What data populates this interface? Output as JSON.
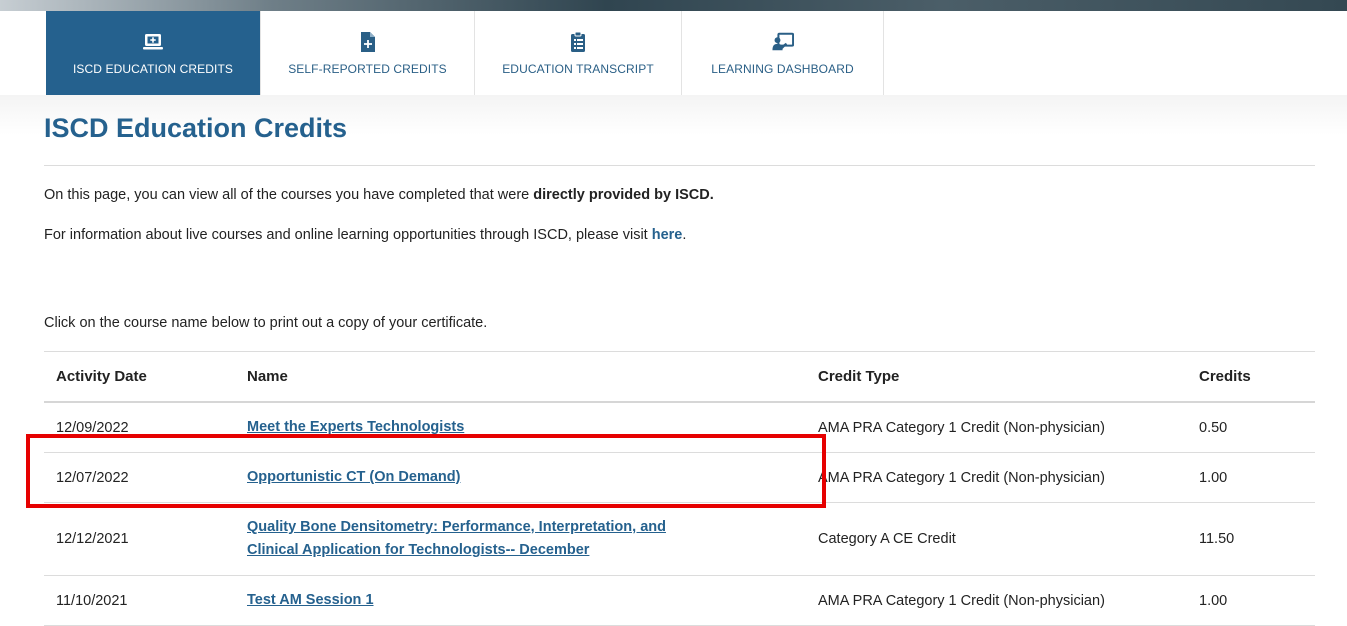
{
  "tabs": [
    {
      "label": "ISCD EDUCATION CREDITS",
      "icon": "laptop-plus-icon",
      "active": true
    },
    {
      "label": "SELF-REPORTED CREDITS",
      "icon": "file-plus-icon",
      "active": false
    },
    {
      "label": "EDUCATION TRANSCRIPT",
      "icon": "clipboard-list-icon",
      "active": false
    },
    {
      "label": "LEARNING DASHBOARD",
      "icon": "presenter-board-icon",
      "active": false
    }
  ],
  "page": {
    "title": "ISCD Education Credits",
    "intro_prefix": "On this page, you can view all of the courses you have completed that were ",
    "intro_bold": "directly provided by ISCD.",
    "info_prefix": "For information about live courses and online learning opportunities through ISCD, please visit ",
    "info_link": "here",
    "info_suffix": ".",
    "instruction": "Click on the course name below to print out a copy of your certificate."
  },
  "table": {
    "headers": {
      "date": "Activity Date",
      "name": "Name",
      "type": "Credit Type",
      "credits": "Credits"
    },
    "rows": [
      {
        "date": "12/09/2022",
        "name": "Meet the Experts Technologists",
        "type": "AMA PRA Category 1 Credit (Non-physician)",
        "credits": "0.50"
      },
      {
        "date": "12/07/2022",
        "name": "Opportunistic CT (On Demand)",
        "type": "AMA PRA Category 1 Credit (Non-physician)",
        "credits": "1.00"
      },
      {
        "date": "12/12/2021",
        "name_line1": "Quality Bone Densitometry: Performance, Interpretation, and",
        "name_line2": "Clinical Application for Technologists-- December",
        "type": "Category A CE Credit",
        "credits": "11.50"
      },
      {
        "date": "11/10/2021",
        "name": "Test AM Session 1",
        "type": "AMA PRA Category 1 Credit (Non-physician)",
        "credits": "1.00"
      }
    ]
  },
  "colors": {
    "accent": "#25618e",
    "highlight": "#e60000"
  }
}
